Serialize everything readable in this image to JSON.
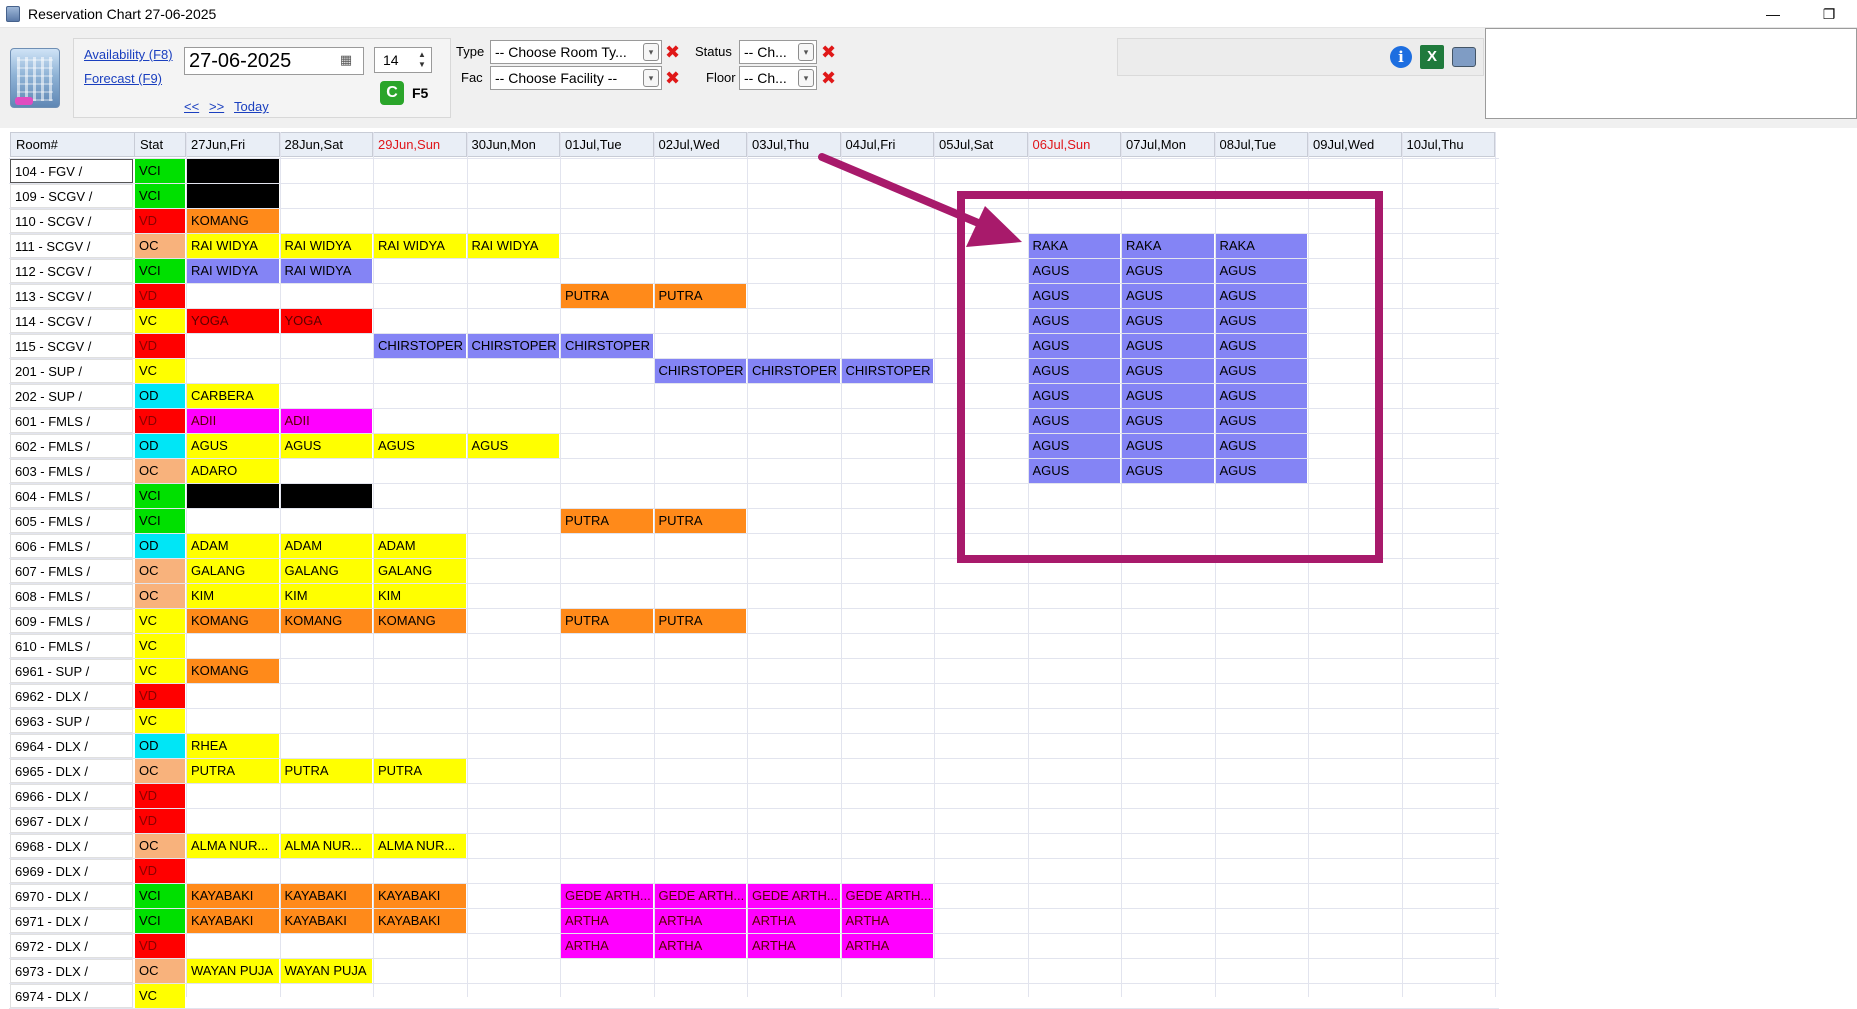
{
  "window": {
    "title": "Reservation Chart 27-06-2025",
    "minimize": "—",
    "restore": "❐"
  },
  "toolbar": {
    "availability": "Availability (F8)",
    "forecast": "Forecast (F9)",
    "date": "27-06-2025",
    "days": "14",
    "prev": "<<",
    "next": ">>",
    "today": "Today",
    "refresh_key": "F5",
    "type_label": "Type",
    "type_value": "-- Choose Room Ty...",
    "fac_label": "Fac",
    "fac_value": "-- Choose Facility --",
    "status_label": "Status",
    "status_value": "-- Ch...",
    "floor_label": "Floor",
    "floor_value": "-- Ch..."
  },
  "icons": {
    "info": "i",
    "excel": "X",
    "print": "",
    "refresh": "C",
    "calendar": "▦",
    "dropdown": "▾",
    "clear": "✖"
  },
  "grid": {
    "headers": {
      "room": "Room#",
      "stat": "Stat",
      "dates": [
        "27Jun,Fri",
        "28Jun,Sat",
        "29Jun,Sun",
        "30Jun,Mon",
        "01Jul,Tue",
        "02Jul,Wed",
        "03Jul,Thu",
        "04Jul,Fri",
        "05Jul,Sat",
        "06Jul,Sun",
        "07Jul,Mon",
        "08Jul,Tue",
        "09Jul,Wed",
        "10Jul,Thu"
      ],
      "weekend_cols": [
        2,
        9
      ]
    },
    "status_colors": {
      "VCI": "#00e000",
      "VD": "#ff0000",
      "OC": "#f8b27c",
      "VC": "#ffff00",
      "OD": "#00e6f6"
    },
    "booking_colors": {
      "black": "#000000",
      "orange": "#ff8a1a",
      "yellow": "#ffff00",
      "blue": "#8484f5",
      "red": "#ff0000",
      "magenta": "#ff00ff"
    },
    "rows": [
      {
        "room": "104 - FGV /",
        "stat": "VCI",
        "bookings": [
          {
            "col": 0,
            "span": 1,
            "name": "",
            "color": "black"
          }
        ]
      },
      {
        "room": "109 - SCGV /",
        "stat": "VCI",
        "bookings": [
          {
            "col": 0,
            "span": 1,
            "name": "",
            "color": "black"
          }
        ]
      },
      {
        "room": "110 - SCGV /",
        "stat": "VD",
        "bookings": [
          {
            "col": 0,
            "span": 1,
            "name": "KOMANG",
            "color": "orange"
          }
        ]
      },
      {
        "room": "111 - SCGV /",
        "stat": "OC",
        "bookings": [
          {
            "col": 0,
            "span": 4,
            "name": "RAI WIDYA",
            "color": "yellow"
          },
          {
            "col": 9,
            "span": 3,
            "name": "RAKA",
            "color": "blue"
          }
        ]
      },
      {
        "room": "112 - SCGV /",
        "stat": "VCI",
        "bookings": [
          {
            "col": 0,
            "span": 2,
            "name": "RAI WIDYA",
            "color": "blue"
          },
          {
            "col": 9,
            "span": 3,
            "name": "AGUS",
            "color": "blue"
          }
        ]
      },
      {
        "room": "113 - SCGV /",
        "stat": "VD",
        "bookings": [
          {
            "col": 4,
            "span": 2,
            "name": "PUTRA",
            "color": "orange"
          },
          {
            "col": 9,
            "span": 3,
            "name": "AGUS",
            "color": "blue"
          }
        ]
      },
      {
        "room": "114 - SCGV /",
        "stat": "VC",
        "bookings": [
          {
            "col": 0,
            "span": 2,
            "name": "YOGA",
            "color": "red"
          },
          {
            "col": 9,
            "span": 3,
            "name": "AGUS",
            "color": "blue"
          }
        ]
      },
      {
        "room": "115 - SCGV /",
        "stat": "VD",
        "bookings": [
          {
            "col": 2,
            "span": 3,
            "name": "CHIRSTOPER",
            "color": "blue"
          },
          {
            "col": 9,
            "span": 3,
            "name": "AGUS",
            "color": "blue"
          }
        ]
      },
      {
        "room": "201 - SUP /",
        "stat": "VC",
        "bookings": [
          {
            "col": 5,
            "span": 3,
            "name": "CHIRSTOPER",
            "color": "blue"
          },
          {
            "col": 9,
            "span": 3,
            "name": "AGUS",
            "color": "blue"
          }
        ]
      },
      {
        "room": "202 - SUP /",
        "stat": "OD",
        "bookings": [
          {
            "col": 0,
            "span": 1,
            "name": "CARBERA",
            "color": "yellow"
          },
          {
            "col": 9,
            "span": 3,
            "name": "AGUS",
            "color": "blue"
          }
        ]
      },
      {
        "room": "601 - FMLS /",
        "stat": "VD",
        "bookings": [
          {
            "col": 0,
            "span": 2,
            "name": "ADII",
            "color": "magenta"
          },
          {
            "col": 9,
            "span": 3,
            "name": "AGUS",
            "color": "blue"
          }
        ]
      },
      {
        "room": "602 - FMLS /",
        "stat": "OD",
        "bookings": [
          {
            "col": 0,
            "span": 4,
            "name": "AGUS",
            "color": "yellow"
          },
          {
            "col": 9,
            "span": 3,
            "name": "AGUS",
            "color": "blue"
          }
        ]
      },
      {
        "room": "603 - FMLS /",
        "stat": "OC",
        "bookings": [
          {
            "col": 0,
            "span": 1,
            "name": "ADARO",
            "color": "yellow"
          },
          {
            "col": 9,
            "span": 3,
            "name": "AGUS",
            "color": "blue"
          }
        ]
      },
      {
        "room": "604 - FMLS /",
        "stat": "VCI",
        "bookings": [
          {
            "col": 0,
            "span": 2,
            "name": "",
            "color": "black"
          }
        ]
      },
      {
        "room": "605 - FMLS /",
        "stat": "VCI",
        "bookings": [
          {
            "col": 4,
            "span": 2,
            "name": "PUTRA",
            "color": "orange"
          }
        ]
      },
      {
        "room": "606 - FMLS /",
        "stat": "OD",
        "bookings": [
          {
            "col": 0,
            "span": 3,
            "name": "ADAM",
            "color": "yellow"
          }
        ]
      },
      {
        "room": "607 - FMLS /",
        "stat": "OC",
        "bookings": [
          {
            "col": 0,
            "span": 3,
            "name": "GALANG",
            "color": "yellow"
          }
        ]
      },
      {
        "room": "608 - FMLS /",
        "stat": "OC",
        "bookings": [
          {
            "col": 0,
            "span": 3,
            "name": "KIM",
            "color": "yellow"
          }
        ]
      },
      {
        "room": "609 - FMLS /",
        "stat": "VC",
        "bookings": [
          {
            "col": 0,
            "span": 3,
            "name": "KOMANG",
            "color": "orange"
          },
          {
            "col": 4,
            "span": 2,
            "name": "PUTRA",
            "color": "orange"
          }
        ]
      },
      {
        "room": "610 - FMLS /",
        "stat": "VC",
        "bookings": []
      },
      {
        "room": "6961 - SUP /",
        "stat": "VC",
        "bookings": [
          {
            "col": 0,
            "span": 1,
            "name": "KOMANG",
            "color": "orange"
          }
        ]
      },
      {
        "room": "6962 - DLX /",
        "stat": "VD",
        "bookings": []
      },
      {
        "room": "6963 - SUP /",
        "stat": "VC",
        "bookings": []
      },
      {
        "room": "6964 - DLX /",
        "stat": "OD",
        "bookings": [
          {
            "col": 0,
            "span": 1,
            "name": "RHEA",
            "color": "yellow"
          }
        ]
      },
      {
        "room": "6965 - DLX /",
        "stat": "OC",
        "bookings": [
          {
            "col": 0,
            "span": 3,
            "name": "PUTRA",
            "color": "yellow"
          }
        ]
      },
      {
        "room": "6966 - DLX /",
        "stat": "VD",
        "bookings": []
      },
      {
        "room": "6967 - DLX /",
        "stat": "VD",
        "bookings": []
      },
      {
        "room": "6968 - DLX /",
        "stat": "OC",
        "bookings": [
          {
            "col": 0,
            "span": 3,
            "name": "ALMA NUR...",
            "color": "yellow"
          }
        ]
      },
      {
        "room": "6969 - DLX /",
        "stat": "VD",
        "bookings": []
      },
      {
        "room": "6970 - DLX /",
        "stat": "VCI",
        "bookings": [
          {
            "col": 0,
            "span": 3,
            "name": "KAYABAKI",
            "color": "orange"
          },
          {
            "col": 4,
            "span": 4,
            "name": "GEDE ARTH...",
            "color": "magenta"
          }
        ]
      },
      {
        "room": "6971 - DLX /",
        "stat": "VCI",
        "bookings": [
          {
            "col": 0,
            "span": 3,
            "name": "KAYABAKI",
            "color": "orange"
          },
          {
            "col": 4,
            "span": 4,
            "name": "ARTHA",
            "color": "magenta"
          }
        ]
      },
      {
        "room": "6972 - DLX /",
        "stat": "VD",
        "bookings": [
          {
            "col": 4,
            "span": 4,
            "name": "ARTHA",
            "color": "magenta"
          }
        ]
      },
      {
        "room": "6973 - DLX /",
        "stat": "OC",
        "bookings": [
          {
            "col": 0,
            "span": 2,
            "name": "WAYAN PUJA",
            "color": "yellow"
          }
        ]
      },
      {
        "room": "6974 - DLX /",
        "stat": "VC",
        "bookings": []
      }
    ]
  }
}
